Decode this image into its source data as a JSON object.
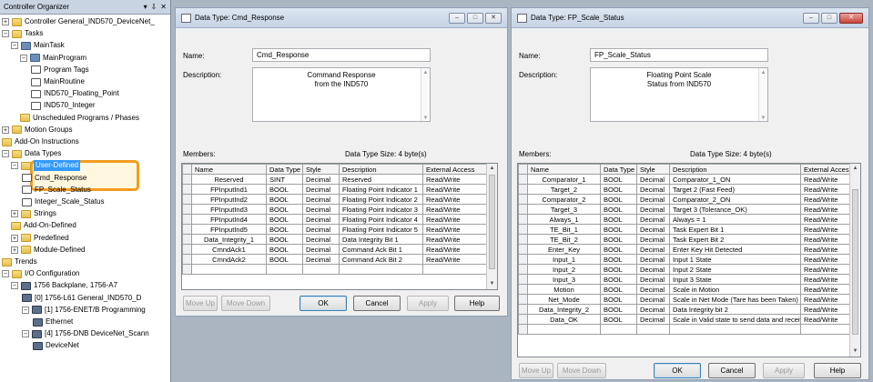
{
  "organizer": {
    "title": "Controller Organizer",
    "controls": [
      "▾",
      "⇩",
      "✕"
    ],
    "tree": [
      {
        "label": "Controller General_IND570_DeviceNet_",
        "expand": "+",
        "icon": "folder"
      },
      {
        "label": "Tasks",
        "expand": "−",
        "icon": "folder"
      },
      {
        "label": "MainTask",
        "expand": "−",
        "icon": "gear"
      },
      {
        "label": "MainProgram",
        "expand": "−",
        "icon": "gear"
      },
      {
        "label": "Program Tags",
        "expand": "",
        "icon": "doc"
      },
      {
        "label": "MainRoutine",
        "expand": "",
        "icon": "doc"
      },
      {
        "label": "IND570_Floating_Point",
        "expand": "",
        "icon": "doc"
      },
      {
        "label": "IND570_Integer",
        "expand": "",
        "icon": "doc"
      },
      {
        "label": "Unscheduled Programs / Phases",
        "expand": "",
        "icon": "folder"
      },
      {
        "label": "Motion Groups",
        "expand": "+",
        "icon": "folder"
      },
      {
        "label": "Add-On Instructions",
        "expand": "",
        "icon": "folder"
      },
      {
        "label": "Data Types",
        "expand": "−",
        "icon": "folder"
      },
      {
        "label": "User-Defined",
        "expand": "−",
        "icon": "folder"
      },
      {
        "label": "Cmd_Response",
        "expand": "",
        "icon": "doc"
      },
      {
        "label": "FP_Scale_Status",
        "expand": "",
        "icon": "doc"
      },
      {
        "label": "Integer_Scale_Status",
        "expand": "",
        "icon": "doc"
      },
      {
        "label": "Strings",
        "expand": "+",
        "icon": "folder"
      },
      {
        "label": "Add-On-Defined",
        "expand": "",
        "icon": "folder"
      },
      {
        "label": "Predefined",
        "expand": "+",
        "icon": "folder"
      },
      {
        "label": "Module-Defined",
        "expand": "+",
        "icon": "folder"
      },
      {
        "label": "Trends",
        "expand": "",
        "icon": "folder"
      },
      {
        "label": "I/O Configuration",
        "expand": "−",
        "icon": "folder"
      },
      {
        "label": "1756 Backplane, 1756-A7",
        "expand": "−",
        "icon": "dev"
      },
      {
        "label": "[0] 1756-L61 General_IND570_D",
        "expand": "",
        "icon": "dev"
      },
      {
        "label": "[1] 1756-ENET/B Programming",
        "expand": "−",
        "icon": "dev"
      },
      {
        "label": "Ethernet",
        "expand": "",
        "icon": "dev"
      },
      {
        "label": "[4] 1756-DNB DeviceNet_Scann",
        "expand": "−",
        "icon": "dev"
      },
      {
        "label": "DeviceNet",
        "expand": "",
        "icon": "dev"
      }
    ]
  },
  "win1": {
    "title": "Data Type: Cmd_Response",
    "name_label": "Name:",
    "name_value": "Cmd_Response",
    "description_label": "Description:",
    "description_line1": "Command Response",
    "description_line2": "from the IND570",
    "members_label": "Members:",
    "size_label": "Data Type Size: 4 byte(s)",
    "columns": [
      "Name",
      "Data Type",
      "Style",
      "Description",
      "External Access"
    ],
    "rows": [
      [
        "Reserved",
        "SINT",
        "Decimal",
        "Reserved",
        "Read/Write"
      ],
      [
        "FPInputInd1",
        "BOOL",
        "Decimal",
        "Floating Point Indicator 1",
        "Read/Write"
      ],
      [
        "FPInputInd2",
        "BOOL",
        "Decimal",
        "Floating Point Indicator 2",
        "Read/Write"
      ],
      [
        "FPInputInd3",
        "BOOL",
        "Decimal",
        "Floating Point Indicator 3",
        "Read/Write"
      ],
      [
        "FPInputInd4",
        "BOOL",
        "Decimal",
        "Floating Point Indicator 4",
        "Read/Write"
      ],
      [
        "FPInputInd5",
        "BOOL",
        "Decimal",
        "Floating Point Indicator 5",
        "Read/Write"
      ],
      [
        "Data_Integrity_1",
        "BOOL",
        "Decimal",
        "Data Integrity Bit 1",
        "Read/Write"
      ],
      [
        "CmndAck1",
        "BOOL",
        "Decimal",
        "Command Ack Bit 1",
        "Read/Write"
      ],
      [
        "CmndAck2",
        "BOOL",
        "Decimal",
        "Command Ack Bit 2",
        "Read/Write"
      ]
    ],
    "buttons": {
      "move_up": "Move Up",
      "move_down": "Move Down",
      "ok": "OK",
      "cancel": "Cancel",
      "apply": "Apply",
      "help": "Help"
    }
  },
  "win2": {
    "title": "Data Type: FP_Scale_Status",
    "name_label": "Name:",
    "name_value": "FP_Scale_Status",
    "description_label": "Description:",
    "description_line1": "Floating Point Scale",
    "description_line2": "Status from IND570",
    "members_label": "Members:",
    "size_label": "Data Type Size: 4 byte(s)",
    "columns": [
      "Name",
      "Data Type",
      "Style",
      "Description",
      "External Acces"
    ],
    "rows": [
      [
        "Comparator_1",
        "BOOL",
        "Decimal",
        "Comparator_1_ON",
        "Read/Write"
      ],
      [
        "Target_2",
        "BOOL",
        "Decimal",
        "Target 2 (Fast Feed)",
        "Read/Write"
      ],
      [
        "Comparator_2",
        "BOOL",
        "Decimal",
        "Comparator_2_ON",
        "Read/Write"
      ],
      [
        "Target_3",
        "BOOL",
        "Decimal",
        "Target 3 (Tolerance_OK)",
        "Read/Write"
      ],
      [
        "Always_1",
        "BOOL",
        "Decimal",
        "Always = 1",
        "Read/Write"
      ],
      [
        "TE_Bit_1",
        "BOOL",
        "Decimal",
        "Task Expert Bit 1",
        "Read/Write"
      ],
      [
        "TE_Bit_2",
        "BOOL",
        "Decimal",
        "Task Expert Bit 2",
        "Read/Write"
      ],
      [
        "Enter_Key",
        "BOOL",
        "Decimal",
        "Enter Key Hit Detected",
        "Read/Write"
      ],
      [
        "Input_1",
        "BOOL",
        "Decimal",
        "Input 1 State",
        "Read/Write"
      ],
      [
        "Input_2",
        "BOOL",
        "Decimal",
        "Input 2 State",
        "Read/Write"
      ],
      [
        "Input_3",
        "BOOL",
        "Decimal",
        "Input 3 State",
        "Read/Write"
      ],
      [
        "Motion",
        "BOOL",
        "Decimal",
        "Scale in Motion",
        "Read/Write"
      ],
      [
        "Net_Mode",
        "BOOL",
        "Decimal",
        "Scale in Net Mode (Tare has been Taken)",
        "Read/Write"
      ],
      [
        "Data_Integrity_2",
        "BOOL",
        "Decimal",
        "Data Integrity bit 2",
        "Read/Write"
      ],
      [
        "Data_OK",
        "BOOL",
        "Decimal",
        "Scale in Valid state to send data and receiv",
        "Read/Write"
      ]
    ],
    "buttons": {
      "move_up": "Move Up",
      "move_down": "Move Down",
      "ok": "OK",
      "cancel": "Cancel",
      "apply": "Apply",
      "help": "Help"
    }
  }
}
